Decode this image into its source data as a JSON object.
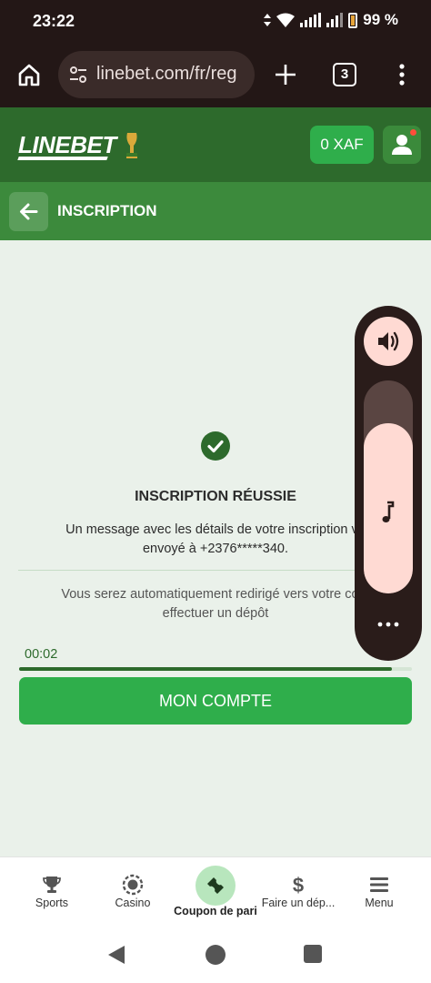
{
  "status_bar": {
    "time": "23:22",
    "battery": "99 %"
  },
  "browser": {
    "url": "linebet.com/fr/reg",
    "tab_count": "3"
  },
  "header": {
    "logo": "LINEBET",
    "balance": "0 XAF"
  },
  "title_bar": {
    "title": "INSCRIPTION"
  },
  "content": {
    "success_title": "INSCRIPTION RÉUSSIE",
    "success_message_line1": "Un message avec les détails de votre inscription vo",
    "success_message_line2": "envoyé à +2376*****340.",
    "redirect_line1": "Vous serez automatiquement redirigé vers votre com",
    "redirect_line2": "effectuer un dépôt",
    "timer": "00:02",
    "progress_fraction": 0.95,
    "account_button": "MON COMPTE"
  },
  "volume_overlay": {
    "level_fraction": 0.8
  },
  "bottom_nav": {
    "items": [
      {
        "label": "Sports",
        "icon": "trophy-icon"
      },
      {
        "label": "Casino",
        "icon": "casino-chip-icon"
      },
      {
        "label": "Coupon de pari",
        "icon": "ticket-icon"
      },
      {
        "label": "Faire un dép...",
        "icon": "dollar-icon"
      },
      {
        "label": "Menu",
        "icon": "menu-icon"
      }
    ],
    "active_index": 2
  },
  "colors": {
    "header_green": "#2d6a2c",
    "accent_green": "#2fae4b",
    "title_bar_green": "#3c8a3c",
    "browser_bg": "#231716"
  }
}
